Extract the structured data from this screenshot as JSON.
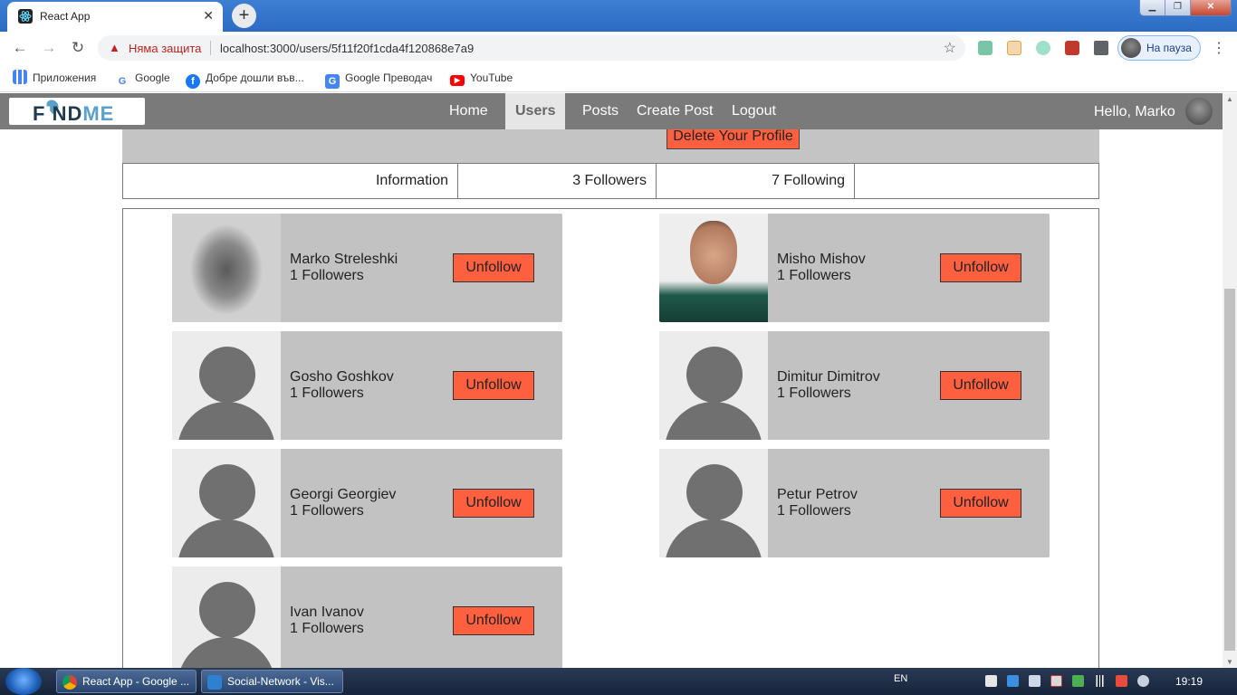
{
  "browser": {
    "tab_title": "React App",
    "tab_close": "✕",
    "new_tab": "+",
    "security_warning": "Няма защита",
    "url": "localhost:3000/users/5f11f20f1cda4f120868e7a9",
    "profile_status": "На пауза",
    "bookmarks": [
      {
        "label": "Приложения",
        "icon": "apps-grid-icon"
      },
      {
        "label": "Google",
        "icon": "google-icon"
      },
      {
        "label": "Добре дошли във...",
        "icon": "facebook-icon"
      },
      {
        "label": "Google Преводач",
        "icon": "translate-icon"
      },
      {
        "label": "YouTube",
        "icon": "youtube-icon"
      }
    ]
  },
  "app": {
    "logo_part1": "F",
    "logo_part2": "NDME",
    "logo_i": "I",
    "nav": [
      {
        "label": "Home",
        "active": false
      },
      {
        "label": "Users",
        "active": true
      },
      {
        "label": "Posts",
        "active": false
      },
      {
        "label": "Create Post",
        "active": false
      },
      {
        "label": "Logout",
        "active": false
      }
    ],
    "greeting": "Hello, Marko"
  },
  "profile": {
    "delete_label": "Delete Your Profile",
    "tabs": [
      "Information",
      "3 Followers",
      "7 Following",
      ""
    ]
  },
  "following": [
    {
      "name": "Marko Streleshki",
      "followers": "1 Followers",
      "button": "Unfollow",
      "photo": "real-photo-gray"
    },
    {
      "name": "Misho Mishov",
      "followers": "1 Followers",
      "button": "Unfollow",
      "photo": "real-photo-color"
    },
    {
      "name": "Gosho Goshkov",
      "followers": "1 Followers",
      "button": "Unfollow",
      "photo": "default-avatar"
    },
    {
      "name": "Dimitur Dimitrov",
      "followers": "1 Followers",
      "button": "Unfollow",
      "photo": "default-avatar"
    },
    {
      "name": "Georgi Georgiev",
      "followers": "1 Followers",
      "button": "Unfollow",
      "photo": "default-avatar"
    },
    {
      "name": "Petur Petrov",
      "followers": "1 Followers",
      "button": "Unfollow",
      "photo": "default-avatar"
    },
    {
      "name": "Ivan Ivanov",
      "followers": "1 Followers",
      "button": "Unfollow",
      "photo": "default-avatar"
    }
  ],
  "taskbar": {
    "items": [
      {
        "label": "React App - Google ...",
        "icon": "chrome-icon"
      },
      {
        "label": "Social-Network - Vis...",
        "icon": "vscode-icon"
      }
    ],
    "language": "EN",
    "time": "19:19"
  },
  "colors": {
    "accent_button": "#fe5f3f",
    "navbar": "#7a7a7a",
    "card": "#c2c2c2"
  }
}
